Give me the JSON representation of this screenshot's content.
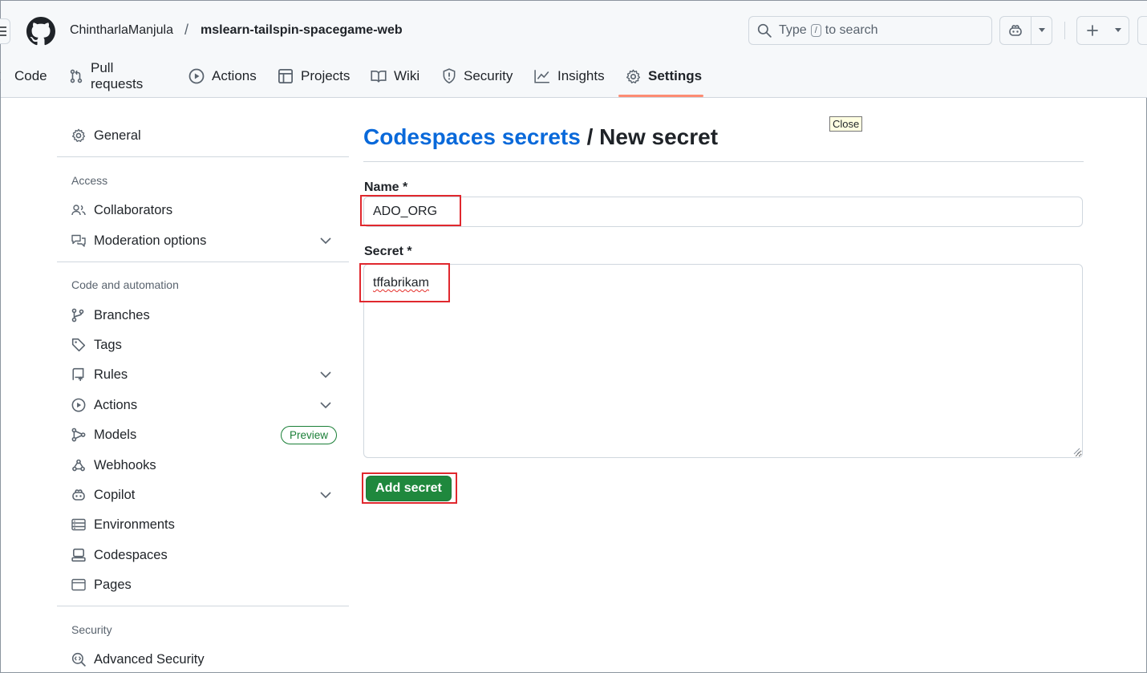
{
  "header": {
    "owner": "ChintharlaManjula",
    "separator": "/",
    "repo": "mslearn-tailspin-spacegame-web",
    "search_type": "Type",
    "search_key": "/",
    "search_suffix": "to search",
    "icons": [
      "hamburger-icon",
      "github-logo-icon",
      "search-icon",
      "copilot-icon",
      "triangle-down-icon",
      "plus-icon"
    ]
  },
  "tabs": [
    {
      "label": "Code",
      "icon": "code-icon"
    },
    {
      "label": "Pull requests",
      "icon": "pull-request-icon"
    },
    {
      "label": "Actions",
      "icon": "play-icon"
    },
    {
      "label": "Projects",
      "icon": "table-icon"
    },
    {
      "label": "Wiki",
      "icon": "book-icon"
    },
    {
      "label": "Security",
      "icon": "shield-icon"
    },
    {
      "label": "Insights",
      "icon": "graph-icon"
    },
    {
      "label": "Settings",
      "icon": "gear-icon",
      "selected": true
    }
  ],
  "sidebar": {
    "general": "General",
    "access_heading": "Access",
    "collaborators": "Collaborators",
    "moderation": "Moderation options",
    "code_heading": "Code and automation",
    "branches": "Branches",
    "tags": "Tags",
    "rules": "Rules",
    "actions": "Actions",
    "models": "Models",
    "preview_badge": "Preview",
    "webhooks": "Webhooks",
    "copilot": "Copilot",
    "environments": "Environments",
    "codespaces": "Codespaces",
    "pages": "Pages",
    "security_heading": "Security",
    "advanced_security": "Advanced Security"
  },
  "main": {
    "breadcrumb_link": "Codespaces secrets",
    "breadcrumb_rest": "/ New secret",
    "tooltip": "Close",
    "name_label": "Name *",
    "name_value": "ADO_ORG",
    "secret_label": "Secret *",
    "secret_value": "tffabrikam",
    "add_button": "Add secret"
  },
  "colors": {
    "link": "#0969da",
    "primary_button": "#1f883d",
    "highlight_box": "#e0282e",
    "selected_tab_underline": "#fd8c73"
  }
}
